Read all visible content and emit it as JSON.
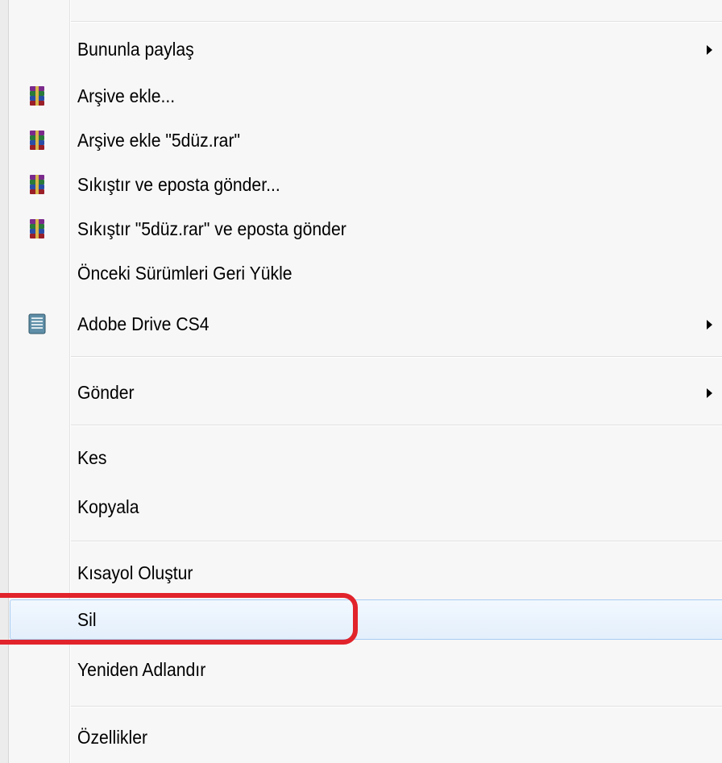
{
  "menu": {
    "items": [
      {
        "label": "Bununla paylaş",
        "submenu": true,
        "icon": ""
      },
      {
        "label": "Arşive ekle...",
        "submenu": false,
        "icon": "winrar-icon"
      },
      {
        "label": "Arşive ekle \"5düz.rar\"",
        "submenu": false,
        "icon": "winrar-icon"
      },
      {
        "label": "Sıkıştır ve eposta gönder...",
        "submenu": false,
        "icon": "winrar-icon"
      },
      {
        "label": "Sıkıştır \"5düz.rar\" ve eposta gönder",
        "submenu": false,
        "icon": "winrar-icon"
      },
      {
        "label": "Önceki Sürümleri Geri Yükle",
        "submenu": false,
        "icon": ""
      },
      {
        "label": "Adobe Drive CS4",
        "submenu": true,
        "icon": "adobe-drive-icon"
      },
      {
        "label": "Gönder",
        "submenu": true,
        "icon": ""
      },
      {
        "label": "Kes",
        "submenu": false,
        "icon": ""
      },
      {
        "label": "Kopyala",
        "submenu": false,
        "icon": ""
      },
      {
        "label": "Kısayol Oluştur",
        "submenu": false,
        "icon": ""
      },
      {
        "label": "Sil",
        "submenu": false,
        "icon": "",
        "hovered": true
      },
      {
        "label": "Yeniden Adlandır",
        "submenu": false,
        "icon": ""
      },
      {
        "label": "Özellikler",
        "submenu": false,
        "icon": ""
      }
    ]
  },
  "colors": {
    "hover_border": "#a9cdf2",
    "annotation_red": "#e1232b"
  }
}
